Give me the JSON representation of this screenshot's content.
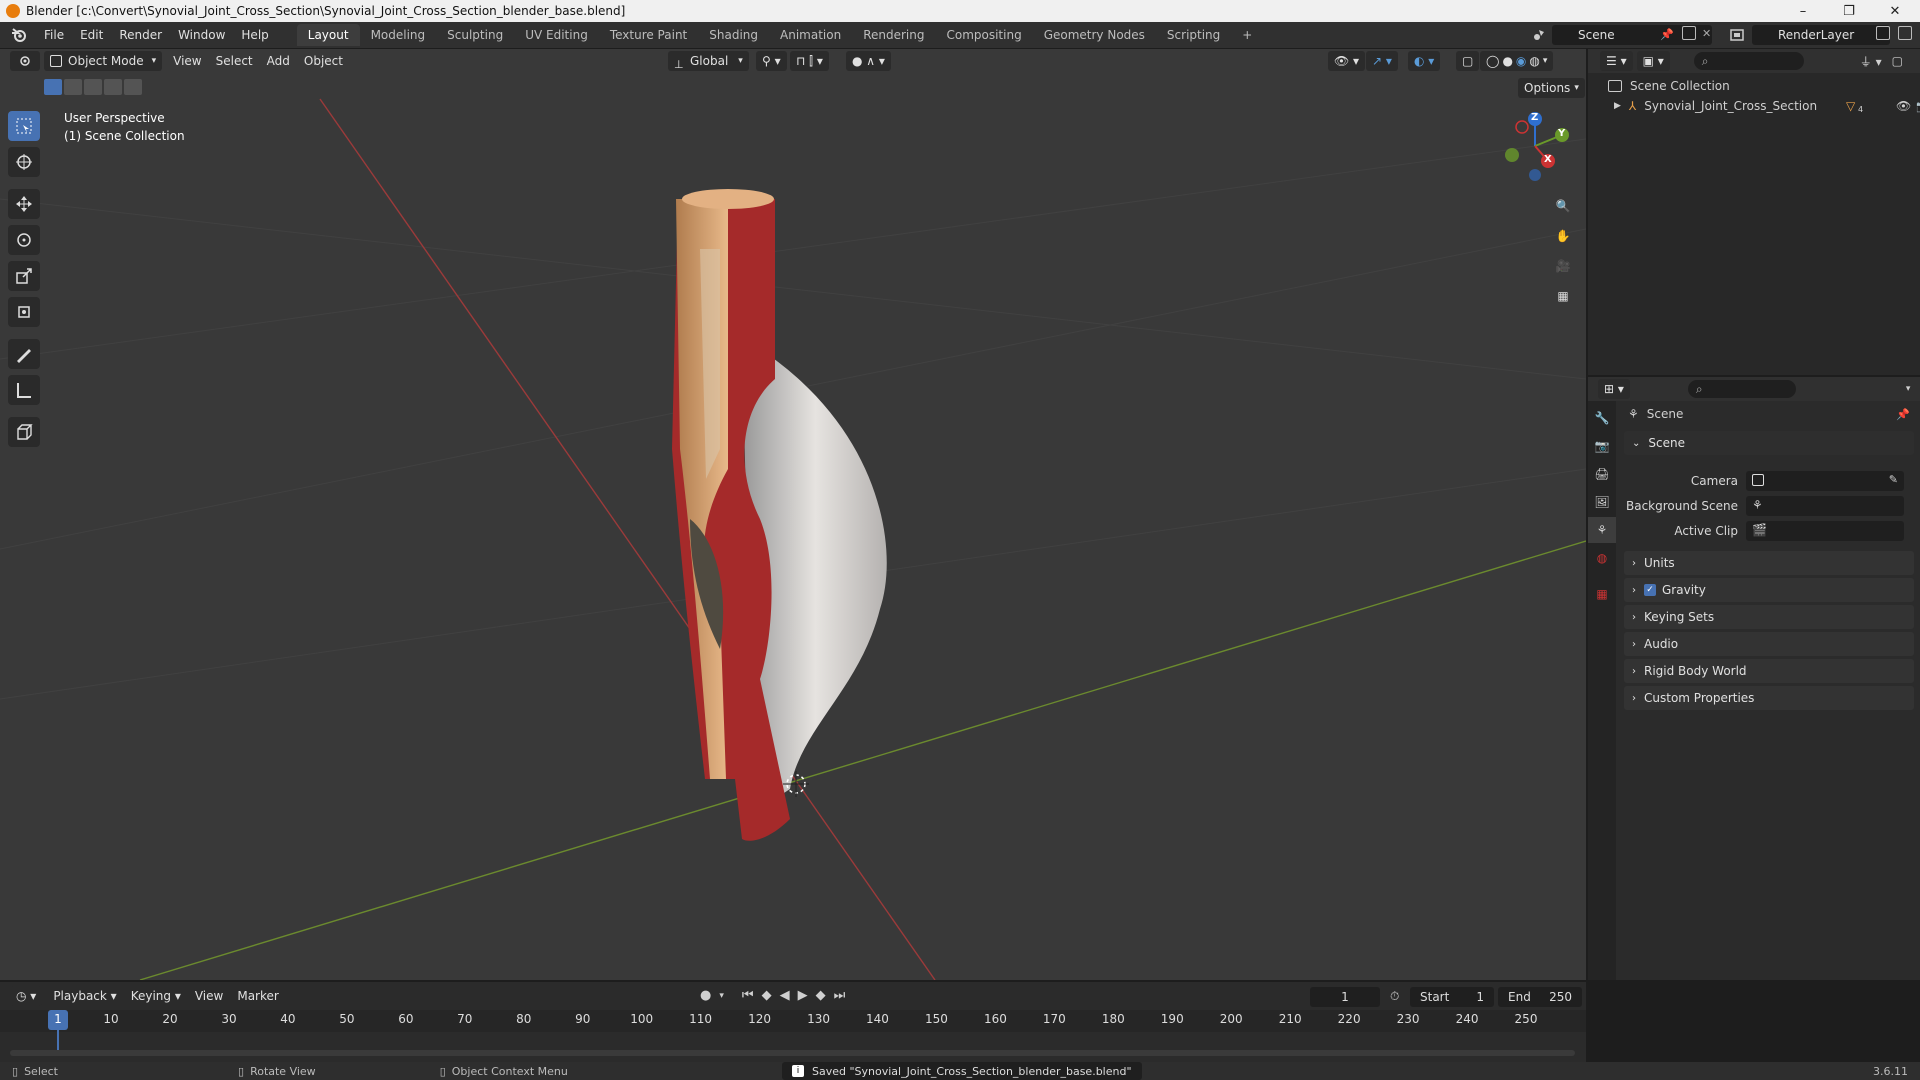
{
  "window": {
    "title": "Blender [c:\\Convert\\Synovial_Joint_Cross_Section\\Synovial_Joint_Cross_Section_blender_base.blend]",
    "minimize": "–",
    "maximize": "❐",
    "close": "✕"
  },
  "menu": [
    "File",
    "Edit",
    "Render",
    "Window",
    "Help"
  ],
  "workspaces": [
    "Layout",
    "Modeling",
    "Sculpting",
    "UV Editing",
    "Texture Paint",
    "Shading",
    "Animation",
    "Rendering",
    "Compositing",
    "Geometry Nodes",
    "Scripting"
  ],
  "workspace_add": "+",
  "scene_name": "Scene",
  "render_layer": "RenderLayer",
  "viewport": {
    "mode": "Object Mode",
    "menus": [
      "View",
      "Select",
      "Add",
      "Object"
    ],
    "orientation": "Global",
    "options": "Options",
    "overlay_line1": "User Perspective",
    "overlay_line2": "(1) Scene Collection",
    "axis_x": "X",
    "axis_y": "Y",
    "axis_z": "Z"
  },
  "outliner": {
    "root": "Scene Collection",
    "item": "Synovial_Joint_Cross_Section",
    "badge": "4"
  },
  "properties": {
    "header": "Scene",
    "panel": "Scene",
    "camera_label": "Camera",
    "background_label": "Background Scene",
    "clip_label": "Active Clip",
    "sections": [
      "Units",
      "Gravity",
      "Keying Sets",
      "Audio",
      "Rigid Body World",
      "Custom Properties"
    ]
  },
  "timeline": {
    "menus": [
      "Playback",
      "Keying",
      "View",
      "Marker"
    ],
    "current_frame": "1",
    "start_label": "Start",
    "start": "1",
    "end_label": "End",
    "end": "250",
    "ticks": [
      "1",
      "10",
      "20",
      "30",
      "40",
      "50",
      "60",
      "70",
      "80",
      "90",
      "100",
      "110",
      "120",
      "130",
      "140",
      "150",
      "160",
      "170",
      "180",
      "190",
      "200",
      "210",
      "220",
      "230",
      "240",
      "250"
    ]
  },
  "status": {
    "select": "Select",
    "rotate": "Rotate View",
    "context": "Object Context Menu",
    "message": "Saved \"Synovial_Joint_Cross_Section_blender_base.blend\"",
    "version": "3.6.11"
  }
}
